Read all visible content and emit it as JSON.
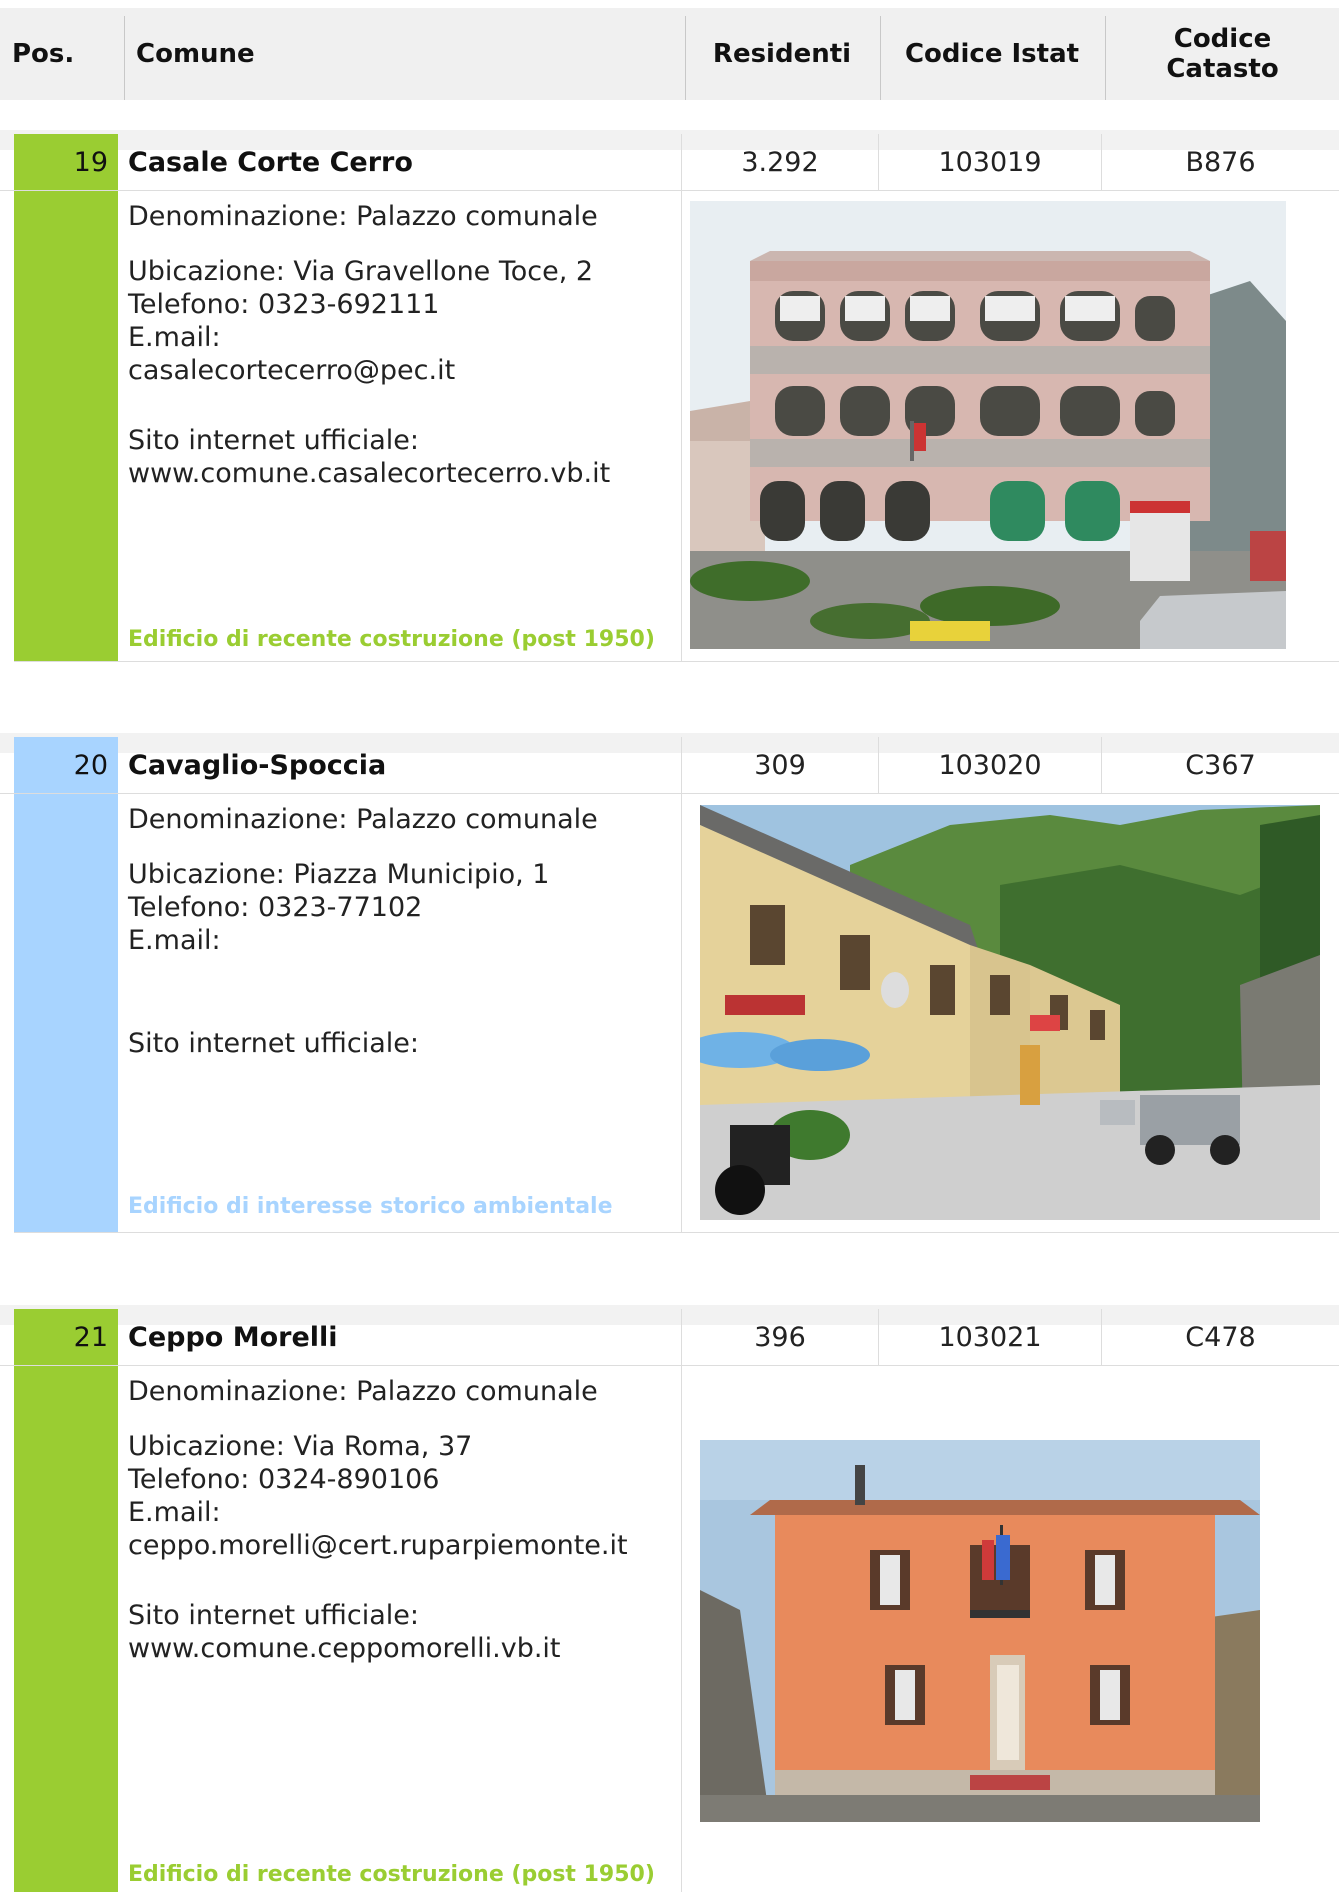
{
  "header": {
    "pos": "Pos.",
    "comune": "Comune",
    "residenti": "Residenti",
    "codice_istat": "Codice Istat",
    "codice_catasto": "Codice\nCatasto"
  },
  "colors": {
    "modern": "#9acd32",
    "historic": "#a8d4ff"
  },
  "entries": [
    {
      "pos": "19",
      "comune": "Casale Corte Cerro",
      "residenti": "3.292",
      "istat": "103019",
      "catasto": "B876",
      "denominazione": "Denominazione: Palazzo comunale",
      "ubicazione": "Ubicazione: Via Gravellone Toce, 2",
      "telefono": "Telefono: 0323-692111",
      "email_label": "E.mail:",
      "email": "casalecortecerro@pec.it",
      "sito_label": "Sito internet ufficiale:",
      "sito": "www.comune.casalecortecerro.vb.it",
      "note": "Edificio di recente costruzione (post 1950)",
      "category_color": "#9acd32"
    },
    {
      "pos": "20",
      "comune": "Cavaglio-Spoccia",
      "residenti": "309",
      "istat": "103020",
      "catasto": "C367",
      "denominazione": "Denominazione: Palazzo comunale",
      "ubicazione": "Ubicazione: Piazza Municipio, 1",
      "telefono": "Telefono: 0323-77102",
      "email_label": "E.mail:",
      "email": "",
      "sito_label": "Sito internet ufficiale:",
      "sito": "",
      "note": "Edificio di interesse storico ambientale",
      "category_color": "#a8d4ff"
    },
    {
      "pos": "21",
      "comune": "Ceppo Morelli",
      "residenti": "396",
      "istat": "103021",
      "catasto": "C478",
      "denominazione": "Denominazione: Palazzo comunale",
      "ubicazione": "Ubicazione: Via Roma, 37",
      "telefono": "Telefono: 0324-890106",
      "email_label": "E.mail:",
      "email": "ceppo.morelli@cert.ruparpiemonte.it",
      "sito_label": "Sito internet ufficiale:",
      "sito": "www.comune.ceppomorelli.vb.it",
      "note": "Edificio di recente costruzione (post 1950)",
      "category_color": "#9acd32"
    }
  ]
}
